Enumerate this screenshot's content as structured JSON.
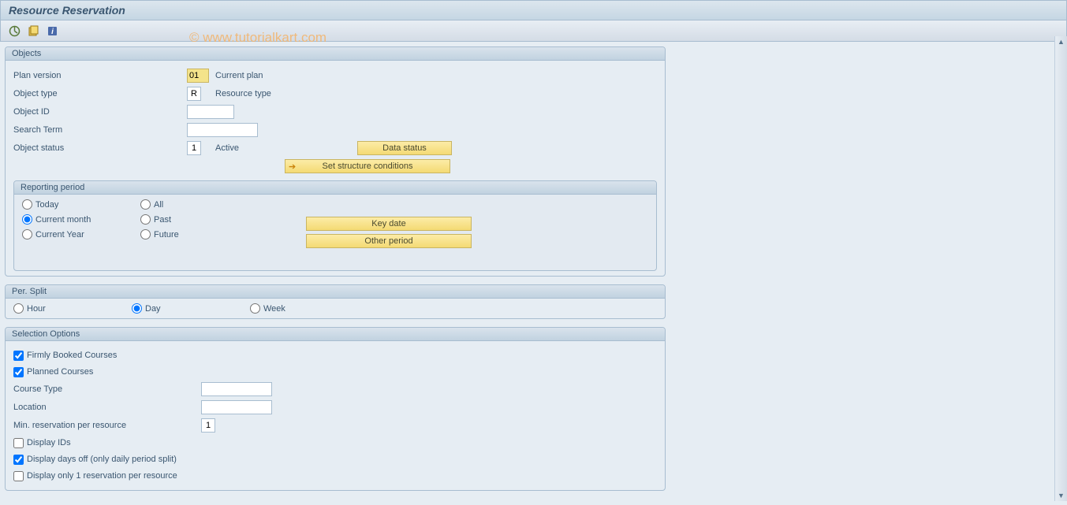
{
  "title": "Resource Reservation",
  "watermark": "© www.tutorialkart.com",
  "objects": {
    "group_title": "Objects",
    "plan_version_label": "Plan version",
    "plan_version_value": "01",
    "plan_version_desc": "Current plan",
    "object_type_label": "Object type",
    "object_type_value": "R",
    "object_type_desc": "Resource type",
    "object_id_label": "Object ID",
    "object_id_value": "",
    "search_term_label": "Search Term",
    "search_term_value": "",
    "object_status_label": "Object status",
    "object_status_value": "1",
    "object_status_desc": "Active",
    "data_status_btn": "Data status",
    "set_structure_btn": "Set structure conditions"
  },
  "reporting": {
    "group_title": "Reporting period",
    "today": "Today",
    "all": "All",
    "current_month": "Current month",
    "past": "Past",
    "current_year": "Current Year",
    "future": "Future",
    "key_date_btn": "Key date",
    "other_period_btn": "Other period"
  },
  "per_split": {
    "group_title": "Per. Split",
    "hour": "Hour",
    "day": "Day",
    "week": "Week"
  },
  "selection": {
    "group_title": "Selection Options",
    "firmly_booked": "Firmly Booked Courses",
    "planned": "Planned Courses",
    "course_type_label": "Course Type",
    "course_type_value": "",
    "location_label": "Location",
    "location_value": "",
    "min_reservation_label": "Min. reservation per resource",
    "min_reservation_value": "1",
    "display_ids": "Display IDs",
    "display_days_off": "Display days off (only daily period split)",
    "display_only_1": "Display only 1 reservation per resource"
  }
}
